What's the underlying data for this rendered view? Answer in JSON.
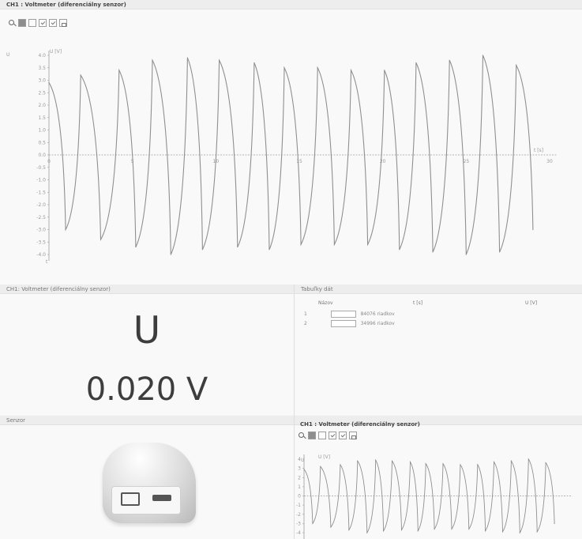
{
  "colors": {
    "background": "#f6f6f6",
    "signal": "#8f8f8f",
    "axis": "#9e9e9e"
  },
  "main_graph": {
    "title": "CH1 : Voltmeter (diferenciálny senzor)",
    "toolbar": [
      "zoom-icon",
      "grid-icon",
      "square-icon",
      "check-icon",
      "check-icon",
      "lock-icon"
    ],
    "y_axis_short": "U",
    "y_axis_label": "U [V]",
    "x_axis_short": "t",
    "x_axis_end": "t [s]",
    "y_ticks": [
      "4.0",
      "3.5",
      "3.0",
      "2.5",
      "2.0",
      "1.5",
      "1.0",
      "0.5",
      "0.0",
      "-0.5",
      "-1.0",
      "-1.5",
      "-2.0",
      "-2.5",
      "-3.0",
      "-3.5",
      "-4.0"
    ],
    "x_ticks": [
      "0",
      "5",
      "10",
      "15",
      "20",
      "25",
      "30"
    ]
  },
  "meter": {
    "title": "CH1: Voltmeter (diferenciálny senzor)",
    "symbol": "U",
    "value": "0.020 V"
  },
  "table": {
    "title": "Tabuľky dát",
    "headers": [
      "Názov",
      "t [s]",
      "U [V]"
    ],
    "rows": [
      {
        "index": "1",
        "name": "84076 riadkov"
      },
      {
        "index": "2",
        "name": "34996 riadkov"
      }
    ]
  },
  "device": {
    "title": "Senzor"
  },
  "mini_graph": {
    "title": "CH1 : Voltmeter (diferenciálny senzor)",
    "toolbar": [
      "zoom-icon",
      "grid-icon",
      "square-icon",
      "check-icon",
      "check-icon",
      "lock-icon"
    ],
    "y_axis_short": "U",
    "y_axis_label": "U [V]",
    "y_ticks": [
      "4",
      "3",
      "2",
      "1",
      "0",
      "-1",
      "-2",
      "-3",
      "-4"
    ]
  },
  "chart_data": [
    {
      "type": "line",
      "title": "CH1 : Voltmeter (diferenciálny senzor)",
      "xlabel": "t [s]",
      "ylabel": "U [V]",
      "xlim": [
        0,
        30
      ],
      "ylim": [
        -4.0,
        4.0
      ],
      "series": [
        {
          "x": [
            0,
            1,
            1.9,
            3.1,
            4.2,
            5.2,
            6.2,
            7.3,
            8.3,
            9.2,
            10.2,
            11.3,
            12.3,
            13.2,
            14.1,
            15.1,
            16.1,
            17.1,
            18.1,
            19.1,
            20.1,
            21.0,
            22.0,
            23.0,
            24.0,
            25.0,
            26.0,
            27.0,
            28.0,
            29.0
          ],
          "y": [
            2.9,
            -3.0,
            3.2,
            -3.4,
            3.4,
            -3.7,
            3.8,
            -4.0,
            3.9,
            -3.8,
            3.8,
            -3.7,
            3.7,
            -3.8,
            3.5,
            -3.6,
            3.5,
            -3.6,
            3.4,
            -3.6,
            3.4,
            -3.8,
            3.7,
            -3.9,
            3.8,
            -4.0,
            4.0,
            -3.9,
            3.6,
            -3.0
          ]
        }
      ]
    },
    {
      "type": "line",
      "title": "CH1 : Voltmeter (diferenciálny senzor)",
      "ylabel": "U [V]",
      "ylim": [
        -4,
        4
      ],
      "series": [
        {
          "x": [
            0,
            1,
            1.9,
            3.1,
            4.2,
            5.2,
            6.2,
            7.3,
            8.3,
            9.2,
            10.2,
            11.3,
            12.3,
            13.2,
            14.1,
            15.1,
            16.1,
            17.1,
            18.1,
            19.1,
            20.1,
            21.0,
            22.0,
            23.0,
            24.0,
            25.0,
            26.0,
            27.0,
            28.0,
            29.0
          ],
          "y": [
            2.9,
            -3.0,
            3.2,
            -3.4,
            3.4,
            -3.7,
            3.8,
            -4.0,
            3.9,
            -3.8,
            3.8,
            -3.7,
            3.7,
            -3.8,
            3.5,
            -3.6,
            3.5,
            -3.6,
            3.4,
            -3.6,
            3.4,
            -3.8,
            3.7,
            -3.9,
            3.8,
            -4.0,
            4.0,
            -3.9,
            3.6,
            -3.0
          ]
        }
      ]
    }
  ]
}
